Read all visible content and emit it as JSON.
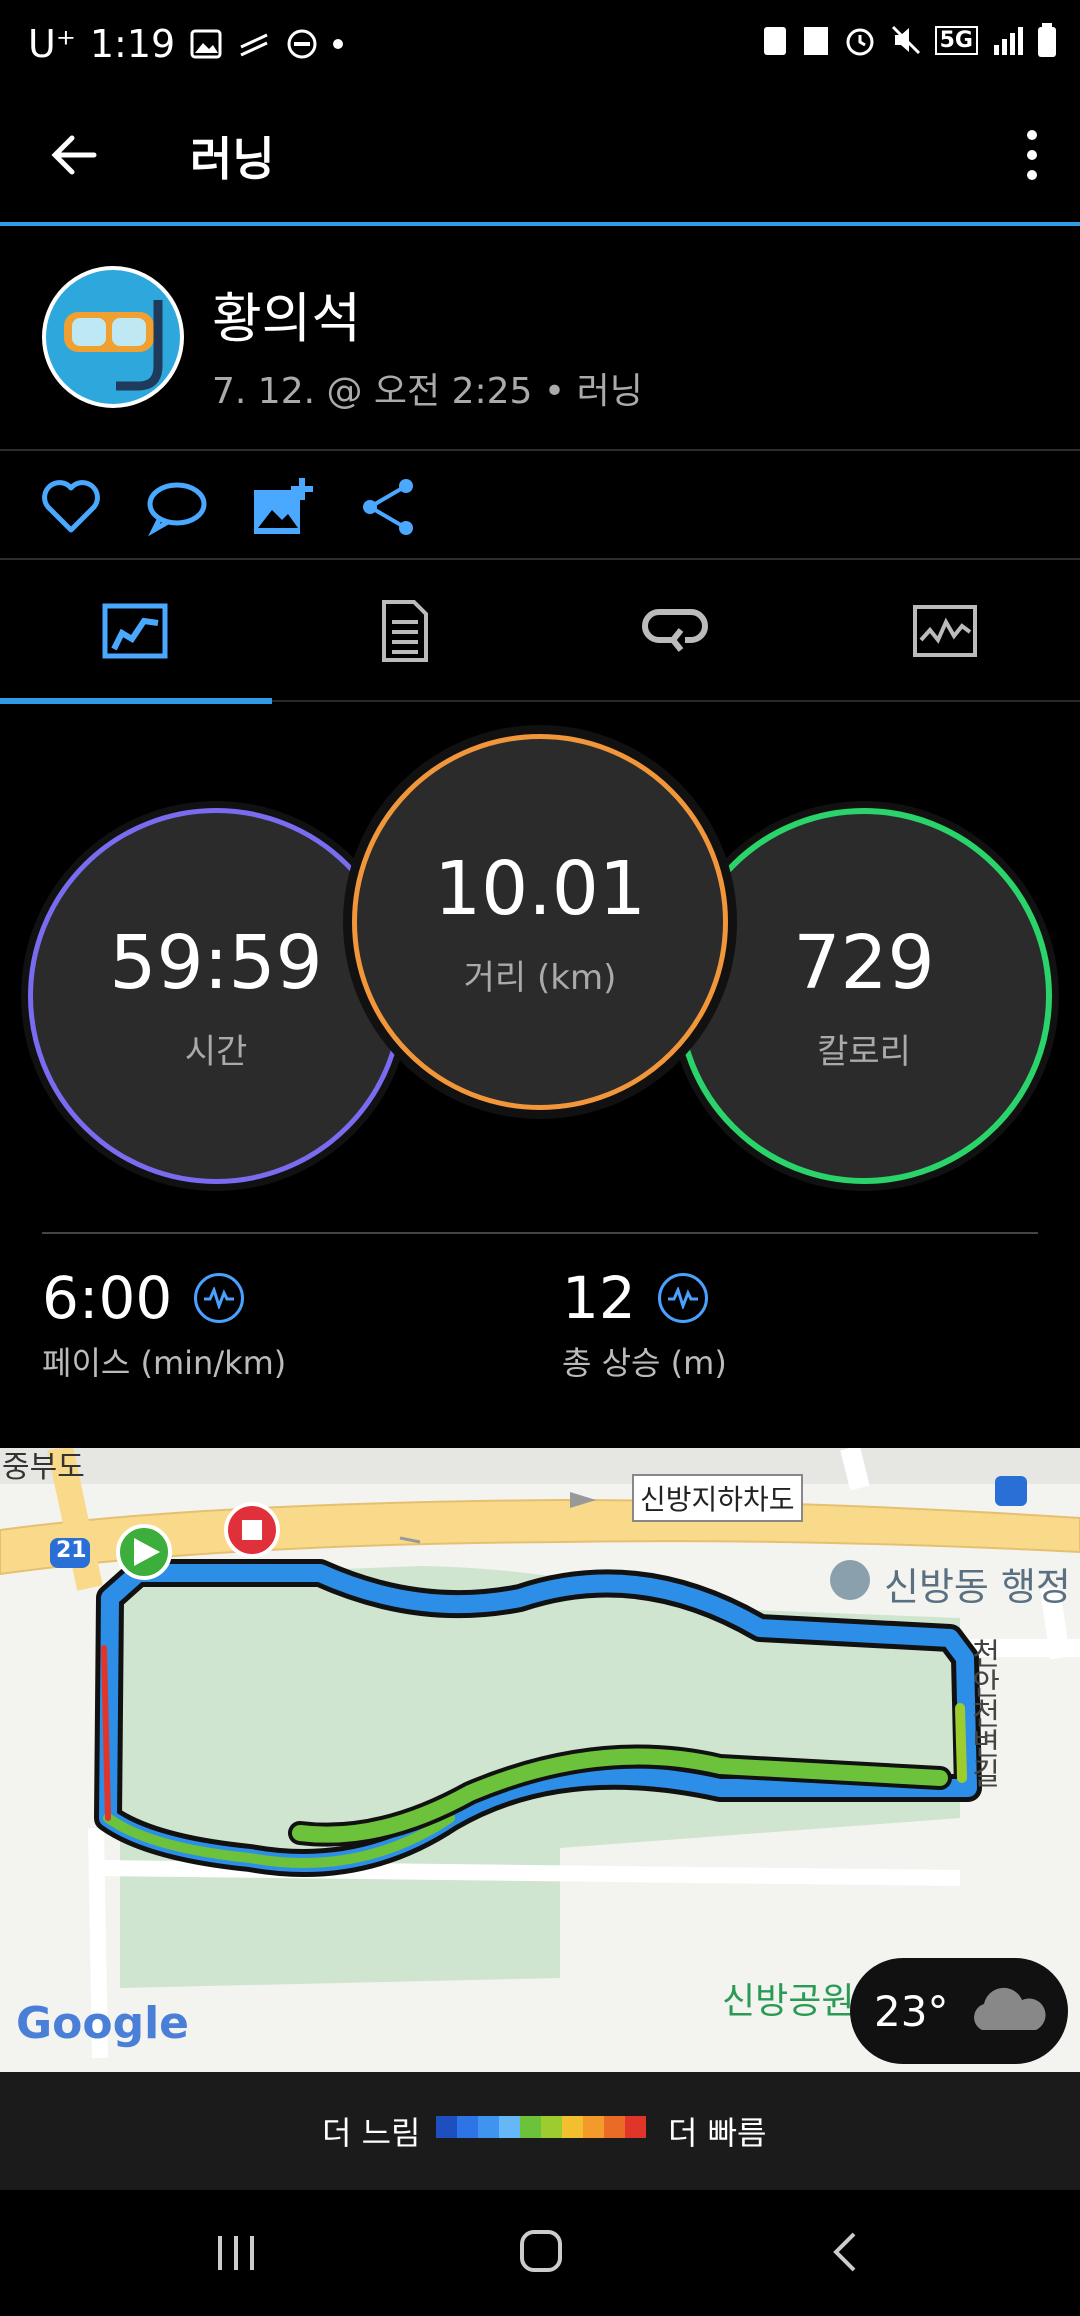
{
  "status_bar": {
    "carrier": "U⁺",
    "time": "1:19",
    "network": "5G"
  },
  "header": {
    "title": "러닝"
  },
  "user": {
    "name": "황의석",
    "meta": "7. 12. @ 오전 2:25 • 러닝"
  },
  "stats": {
    "time": {
      "value": "59:59",
      "label": "시간"
    },
    "distance": {
      "value": "10.01",
      "label": "거리 (km)"
    },
    "calories": {
      "value": "729",
      "label": "칼로리"
    },
    "pace": {
      "value": "6:00",
      "label": "페이스 (min/km)"
    },
    "ascent": {
      "value": "12",
      "label": "총 상승 (m)"
    }
  },
  "map": {
    "labels": {
      "road_top": "중부도",
      "underpass": "신방지하차도",
      "office": "신방동 행정",
      "street": "천안천변길",
      "park": "신방공원",
      "route_no": "21",
      "brand": "Google"
    },
    "weather": {
      "temp": "23°"
    }
  },
  "legend": {
    "slow": "더 느림",
    "fast": "더 빠름",
    "colors": [
      "#1d4fbf",
      "#2d74e6",
      "#3f94f0",
      "#66b7f5",
      "#6cc23a",
      "#9ccc2e",
      "#f2c02e",
      "#f29a2a",
      "#ea6b25",
      "#e0362a"
    ]
  },
  "colors": {
    "accent": "#2f9be6",
    "time_ring": "#7a6cf0",
    "distance_ring": "#f2963a",
    "calories_ring": "#2ad46a"
  }
}
